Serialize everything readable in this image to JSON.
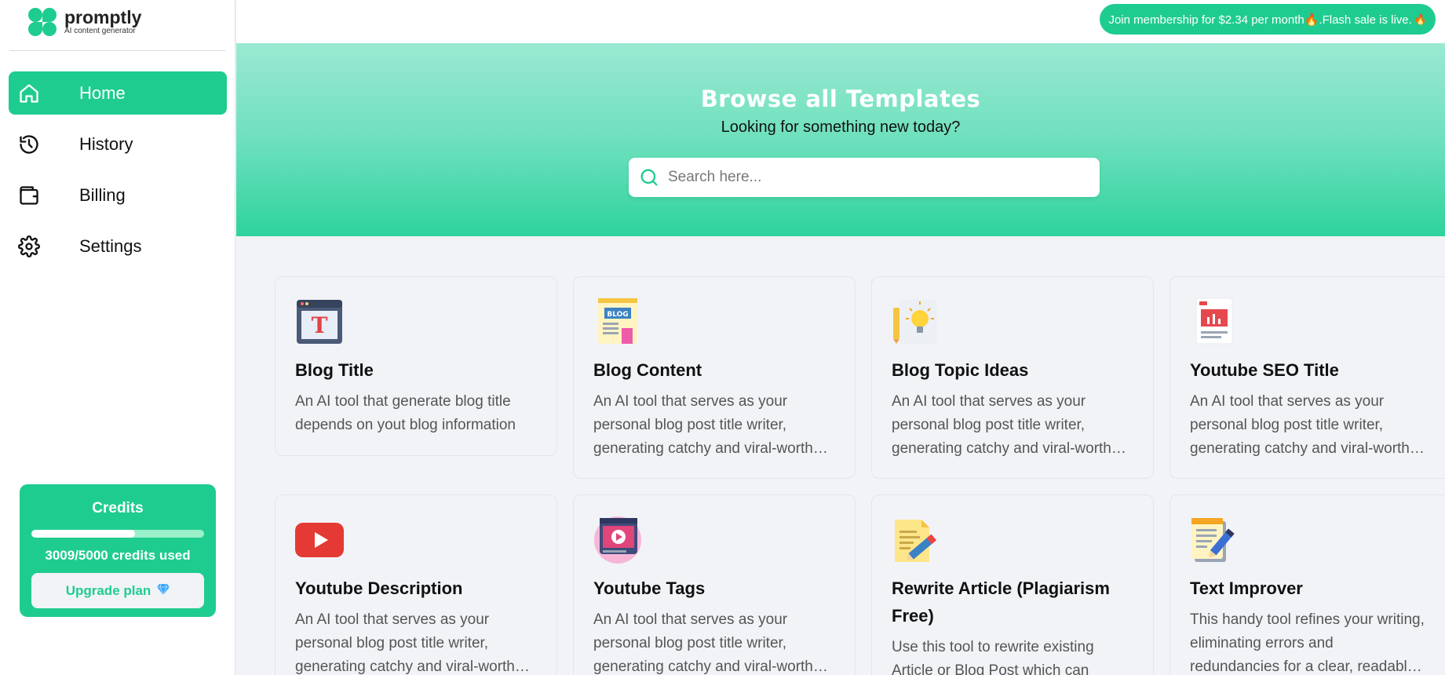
{
  "brand": {
    "name": "promptly",
    "tagline": "AI content generator"
  },
  "nav": [
    {
      "label": "Home",
      "icon": "home-icon",
      "active": true
    },
    {
      "label": "History",
      "icon": "history-icon",
      "active": false
    },
    {
      "label": "Billing",
      "icon": "wallet-icon",
      "active": false
    },
    {
      "label": "Settings",
      "icon": "gear-icon",
      "active": false
    }
  ],
  "credits": {
    "title": "Credits",
    "used": 3009,
    "total": 5000,
    "used_label": "3009/5000 credits used",
    "upgrade_label": "Upgrade plan",
    "upgrade_icon": "diamond-icon"
  },
  "promo": {
    "text": "Join membership for $2.34 per month🔥.Flash sale is live.",
    "icon": "fire-icon"
  },
  "hero": {
    "title": "Browse all Templates",
    "subtitle": "Looking for something new today?",
    "search_placeholder": "Search here..."
  },
  "templates": [
    {
      "title": "Blog Title",
      "icon": "blog-title-icon",
      "desc": "An AI tool that generate blog title depends on yout blog information"
    },
    {
      "title": "Blog Content",
      "icon": "blog-content-icon",
      "desc": "An AI tool that serves as your personal blog post title writer, generating catchy and viral-worthy titles"
    },
    {
      "title": "Blog Topic Ideas",
      "icon": "blog-topic-ideas-icon",
      "desc": "An AI tool that serves as your personal blog post title writer, generating catchy and viral-worthy titles"
    },
    {
      "title": "Youtube SEO Title",
      "icon": "youtube-seo-title-icon",
      "desc": "An AI tool that serves as your personal blog post title writer, generating catchy and viral-worthy titles"
    },
    {
      "title": "Youtube Description",
      "icon": "youtube-icon",
      "desc": "An AI tool that serves as your personal blog post title writer, generating catchy and viral-worthy titles"
    },
    {
      "title": "Youtube Tags",
      "icon": "youtube-tags-icon",
      "desc": "An AI tool that serves as your personal blog post title writer, generating catchy and viral-worthy titles"
    },
    {
      "title": "Rewrite Article (Plagiarism Free)",
      "icon": "rewrite-article-icon",
      "desc": "Use this tool to rewrite existing Article or Blog Post which can bypass AI detectors"
    },
    {
      "title": "Text Improver",
      "icon": "text-improver-icon",
      "desc": "This handy tool refines your writing, eliminating errors and redundancies for a clear, readable result"
    }
  ],
  "colors": {
    "accent": "#1fcc8f",
    "background": "#f1f3f7"
  }
}
